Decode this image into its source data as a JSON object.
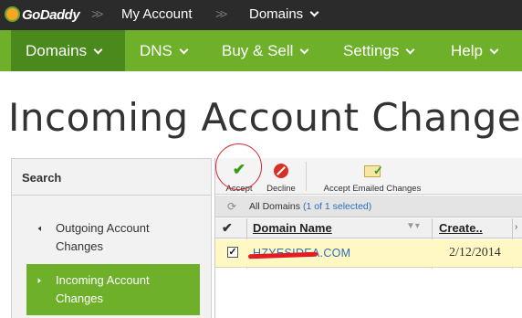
{
  "brand": {
    "logo_text": "GoDaddy",
    "accent": "#6eb02a",
    "accent_dark": "#4a8a1c"
  },
  "topbar": {
    "separator": ">>",
    "my_account": "My Account",
    "domains": "Domains"
  },
  "nav": {
    "items": [
      "Domains",
      "DNS",
      "Buy & Sell",
      "Settings",
      "Help"
    ],
    "active": "Domains"
  },
  "page_title": "Incoming Account Changes",
  "sidebar": {
    "header": "Search",
    "items": [
      {
        "label": "Outgoing Account Changes",
        "icon": "arrow-left-icon",
        "active": false
      },
      {
        "label": "Incoming Account Changes",
        "icon": "arrow-right-icon",
        "active": true
      }
    ]
  },
  "toolbar": {
    "accept": "Accept",
    "decline": "Decline",
    "accept_emailed": "Accept Emailed Changes"
  },
  "list_info": {
    "all_domains": "All Domains",
    "selection_count": "(1 of 1 selected)"
  },
  "table": {
    "columns": [
      "Domain Name",
      "Create.."
    ],
    "rows": [
      {
        "checked": true,
        "domain": "HZYESIDEA.COM",
        "created": "2/12/2014"
      }
    ]
  }
}
